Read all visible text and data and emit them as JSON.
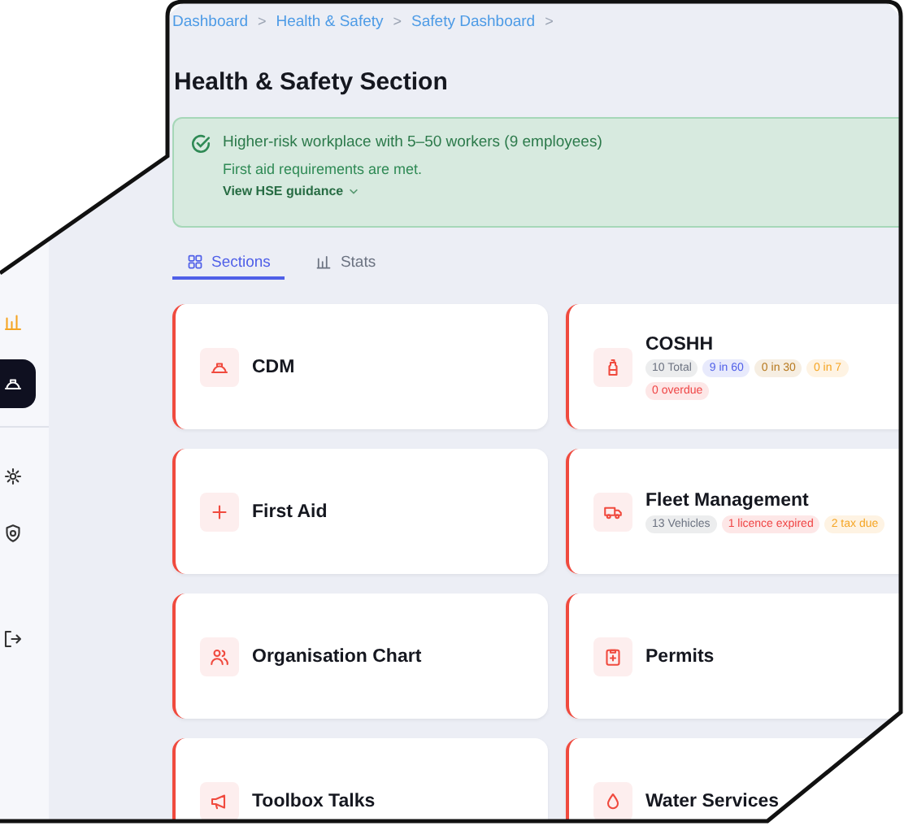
{
  "sidebar": {
    "items": [
      {
        "kind": "chart",
        "selected": false
      },
      {
        "kind": "hardhat",
        "selected": true
      },
      {
        "kind": "gear",
        "selected": false
      },
      {
        "kind": "shield",
        "selected": false
      },
      {
        "kind": "logout",
        "selected": false
      }
    ]
  },
  "breadcrumb": [
    {
      "label": "Dashboard",
      "separator": ">"
    },
    {
      "label": "Health & Safety",
      "separator": ">"
    },
    {
      "label": "Safety Dashboard",
      "separator": ">"
    }
  ],
  "title": "Health & Safety Section",
  "alert": {
    "title": "Higher-risk workplace with 5–50 workers (9 employees)",
    "text": "First aid requirements are met.",
    "link": "View HSE guidance"
  },
  "tabs": [
    {
      "label": "Sections",
      "kind": "grid",
      "selected": true
    },
    {
      "label": "Stats",
      "kind": "bars",
      "selected": false
    }
  ],
  "card_rows": [
    {
      "cards": [
        {
          "title": "CDM",
          "kind": "hardhat"
        },
        {
          "title": "COSHH",
          "kind": "bottle",
          "badges": [
            {
              "text": "10 Total",
              "color": "#6b7280"
            },
            {
              "text": "9 in 60",
              "color": "#4f5fe8"
            },
            {
              "text": "0 in 30",
              "color": "#b7791f"
            },
            {
              "text": "0 in 7",
              "color": "#f5a524"
            },
            {
              "text": "0 overdue",
              "color": "#ef4444"
            }
          ]
        }
      ]
    },
    {
      "cards": [
        {
          "title": "First Aid",
          "kind": "plus"
        },
        {
          "title": "Fleet Management",
          "kind": "truck",
          "badges": [
            {
              "text": "13 Vehicles",
              "color": "#6b7280"
            },
            {
              "text": "1 licence expired",
              "color": "#ef4444"
            },
            {
              "text": "2 tax due",
              "color": "#f5a524"
            }
          ]
        }
      ]
    },
    {
      "cards": [
        {
          "title": "Organisation Chart",
          "kind": "people"
        },
        {
          "title": "Permits",
          "kind": "clipboard"
        }
      ]
    },
    {
      "cards": [
        {
          "title": "Toolbox Talks",
          "kind": "megaphone"
        },
        {
          "title": "Water Services",
          "kind": "drop"
        }
      ]
    }
  ]
}
